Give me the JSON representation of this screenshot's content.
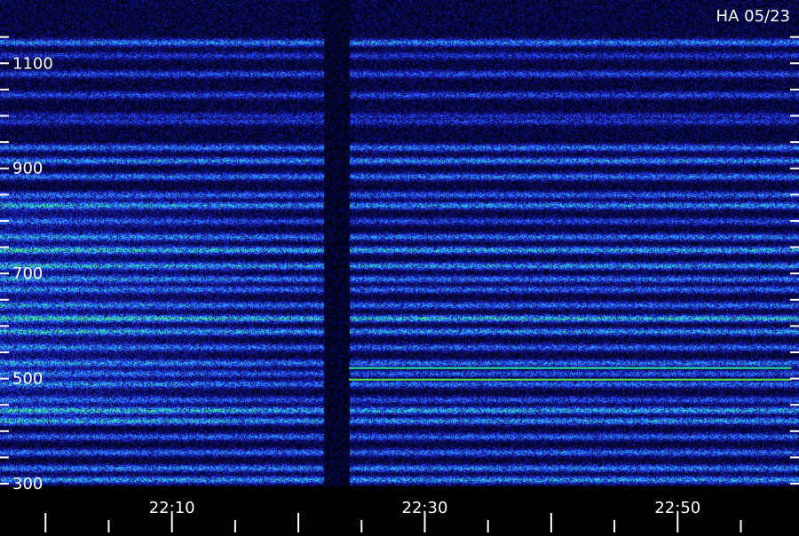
{
  "chart_data": {
    "type": "heatmap",
    "title": "HA 05/23",
    "xlabel": "",
    "ylabel": "",
    "x_tick_labels": [
      "22:10",
      "22:30",
      "22:50"
    ],
    "x_range": [
      "22:00",
      "22:59"
    ],
    "y_tick_labels": [
      "300",
      "500",
      "700",
      "900",
      "1100"
    ],
    "y_ticks": [
      300,
      500,
      700,
      900,
      1100
    ],
    "y_range": [
      295,
      1190
    ],
    "colormap": [
      "#000000",
      "#0a0a6a",
      "#1d2ad6",
      "#2f6bff",
      "#2fb8ff",
      "#2dfc9a",
      "#6cff3a"
    ],
    "gap_times": [
      "22:22",
      "22:24"
    ],
    "bands": [
      {
        "y": 1140,
        "level": 0.45
      },
      {
        "y": 1115,
        "level": 0.25
      },
      {
        "y": 1080,
        "level": 0.32
      },
      {
        "y": 1040,
        "level": 0.3
      },
      {
        "y": 1000,
        "level": 0.22
      },
      {
        "y": 990,
        "level": 0.25
      },
      {
        "y": 940,
        "level": 0.42
      },
      {
        "y": 915,
        "level": 0.48
      },
      {
        "y": 885,
        "level": 0.42
      },
      {
        "y": 850,
        "level": 0.38
      },
      {
        "y": 830,
        "level": 0.48
      },
      {
        "y": 800,
        "level": 0.3
      },
      {
        "y": 770,
        "level": 0.42
      },
      {
        "y": 745,
        "level": 0.55
      },
      {
        "y": 715,
        "level": 0.5
      },
      {
        "y": 690,
        "level": 0.42
      },
      {
        "y": 670,
        "level": 0.38
      },
      {
        "y": 640,
        "level": 0.4
      },
      {
        "y": 615,
        "level": 0.6
      },
      {
        "y": 590,
        "level": 0.5
      },
      {
        "y": 560,
        "level": 0.38
      },
      {
        "y": 530,
        "level": 0.42
      },
      {
        "y": 510,
        "level": 0.35
      },
      {
        "y": 490,
        "level": 0.4
      },
      {
        "y": 460,
        "level": 0.32
      },
      {
        "y": 440,
        "level": 0.55
      },
      {
        "y": 420,
        "level": 0.5
      },
      {
        "y": 390,
        "level": 0.38
      },
      {
        "y": 360,
        "level": 0.4
      },
      {
        "y": 330,
        "level": 0.45
      },
      {
        "y": 308,
        "level": 0.5
      }
    ],
    "lines": [
      {
        "name": "",
        "y": 498,
        "start": "22:24",
        "end": "22:59",
        "color": "#6cff3a"
      },
      {
        "name": "",
        "y": 520,
        "start": "22:24",
        "end": "22:59",
        "color": "#2dfc9a"
      }
    ]
  }
}
